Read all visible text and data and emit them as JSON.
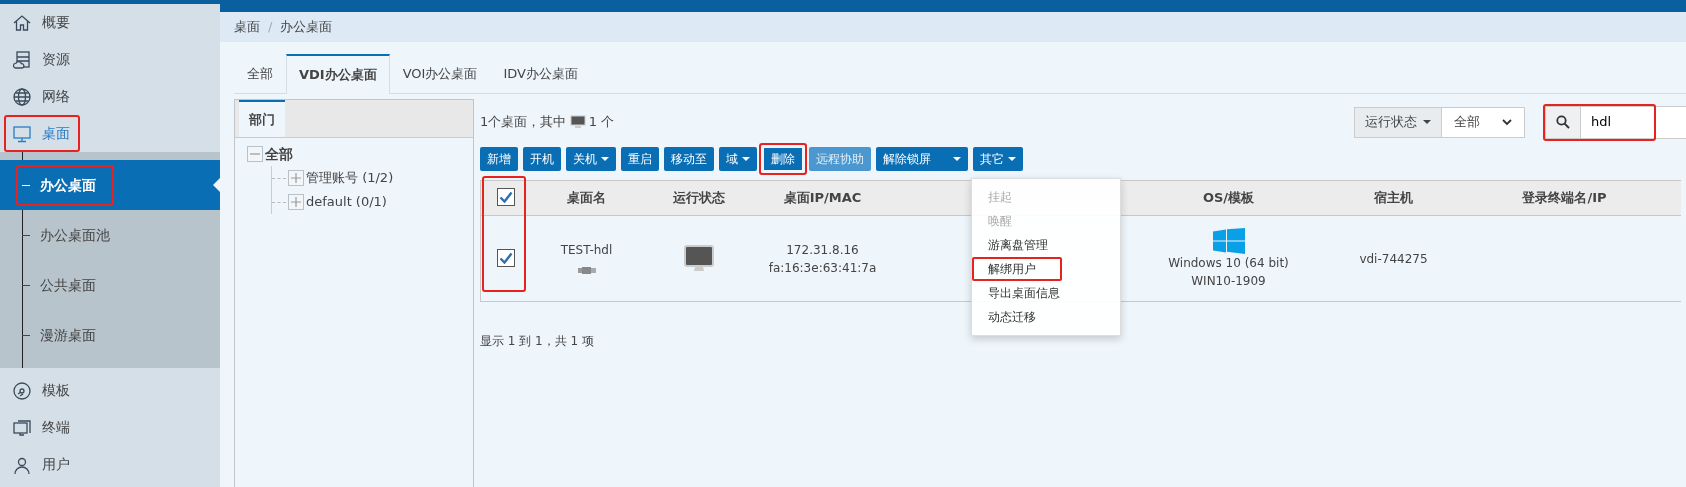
{
  "sidebar": {
    "items": [
      {
        "label": "概要",
        "selected": false,
        "highlighted": false
      },
      {
        "label": "资源",
        "selected": false,
        "highlighted": false
      },
      {
        "label": "网络",
        "selected": false,
        "highlighted": false
      },
      {
        "label": "桌面",
        "selected": true,
        "highlighted": true,
        "expanded": true,
        "children": [
          {
            "label": "办公桌面",
            "selected": true,
            "highlighted": true
          },
          {
            "label": "办公桌面池",
            "selected": false,
            "highlighted": false
          },
          {
            "label": "公共桌面",
            "selected": false,
            "highlighted": false
          },
          {
            "label": "漫游桌面",
            "selected": false,
            "highlighted": false
          }
        ]
      },
      {
        "label": "模板",
        "selected": false,
        "highlighted": false
      },
      {
        "label": "终端",
        "selected": false,
        "highlighted": false
      },
      {
        "label": "用户",
        "selected": false,
        "highlighted": false
      }
    ]
  },
  "breadcrumb": [
    "桌面",
    "办公桌面"
  ],
  "breadcrumb_separator": "/",
  "tabs": [
    {
      "label": "全部",
      "selected": false
    },
    {
      "label": "VDI办公桌面",
      "selected": true
    },
    {
      "label": "VOI办公桌面",
      "selected": false
    },
    {
      "label": "IDV办公桌面",
      "selected": false
    }
  ],
  "panel": {
    "tab": "部门",
    "tree": {
      "label": "全部",
      "expanded": true,
      "children": [
        {
          "label": "管理账号 (1/2)",
          "expanded": false
        },
        {
          "label": "default (0/1)",
          "expanded": false
        }
      ]
    }
  },
  "summary": {
    "text": "1个桌面，其中",
    "count": "1 个"
  },
  "filter": {
    "label": "运行状态",
    "value": "全部"
  },
  "search": {
    "value": "hdl",
    "highlighted": true
  },
  "toolbar": [
    {
      "label": "新增",
      "kind": "plain",
      "highlighted": false,
      "disabled": false
    },
    {
      "label": "开机",
      "kind": "plain",
      "highlighted": false,
      "disabled": false
    },
    {
      "label": "关机",
      "kind": "dropdown",
      "highlighted": false,
      "disabled": false
    },
    {
      "label": "重启",
      "kind": "plain",
      "highlighted": false,
      "disabled": false
    },
    {
      "label": "移动至",
      "kind": "plain",
      "highlighted": false,
      "disabled": false
    },
    {
      "label": "域",
      "kind": "dropdown",
      "highlighted": false,
      "disabled": false
    },
    {
      "label": "删除",
      "kind": "plain",
      "highlighted": true,
      "disabled": false
    },
    {
      "label": "远程协助",
      "kind": "plain",
      "highlighted": false,
      "disabled": true
    },
    {
      "label": "解除锁屏",
      "kind": "split",
      "highlighted": false,
      "disabled": false
    },
    {
      "label": "其它",
      "kind": "dropdown",
      "highlighted": false,
      "disabled": false,
      "menu": [
        {
          "label": "挂起",
          "disabled": true,
          "highlighted": false
        },
        {
          "label": "唤醒",
          "disabled": true,
          "highlighted": false
        },
        {
          "label": "游离盘管理",
          "disabled": false,
          "highlighted": false
        },
        {
          "label": "解绑用户",
          "disabled": false,
          "highlighted": true
        },
        {
          "label": "导出桌面信息",
          "disabled": false,
          "highlighted": false
        },
        {
          "label": "动态迁移",
          "disabled": false,
          "highlighted": false
        }
      ]
    }
  ],
  "table": {
    "all_checked": true,
    "checkbox_column_highlighted": true,
    "columns": [
      "桌面名",
      "运行状态",
      "桌面IP/MAC",
      "OS/模板",
      "宿主机",
      "登录终端名/IP"
    ],
    "rows": [
      {
        "checked": true,
        "name": "TEST-hdl",
        "ip": "172.31.8.16",
        "mac": "fa:16:3e:63:41:7a",
        "os": "Windows 10 (64 bit)",
        "template": "WIN10-1909",
        "host": "vdi-744275"
      }
    ]
  },
  "footer": "显示 1 到 1，共 1 项"
}
